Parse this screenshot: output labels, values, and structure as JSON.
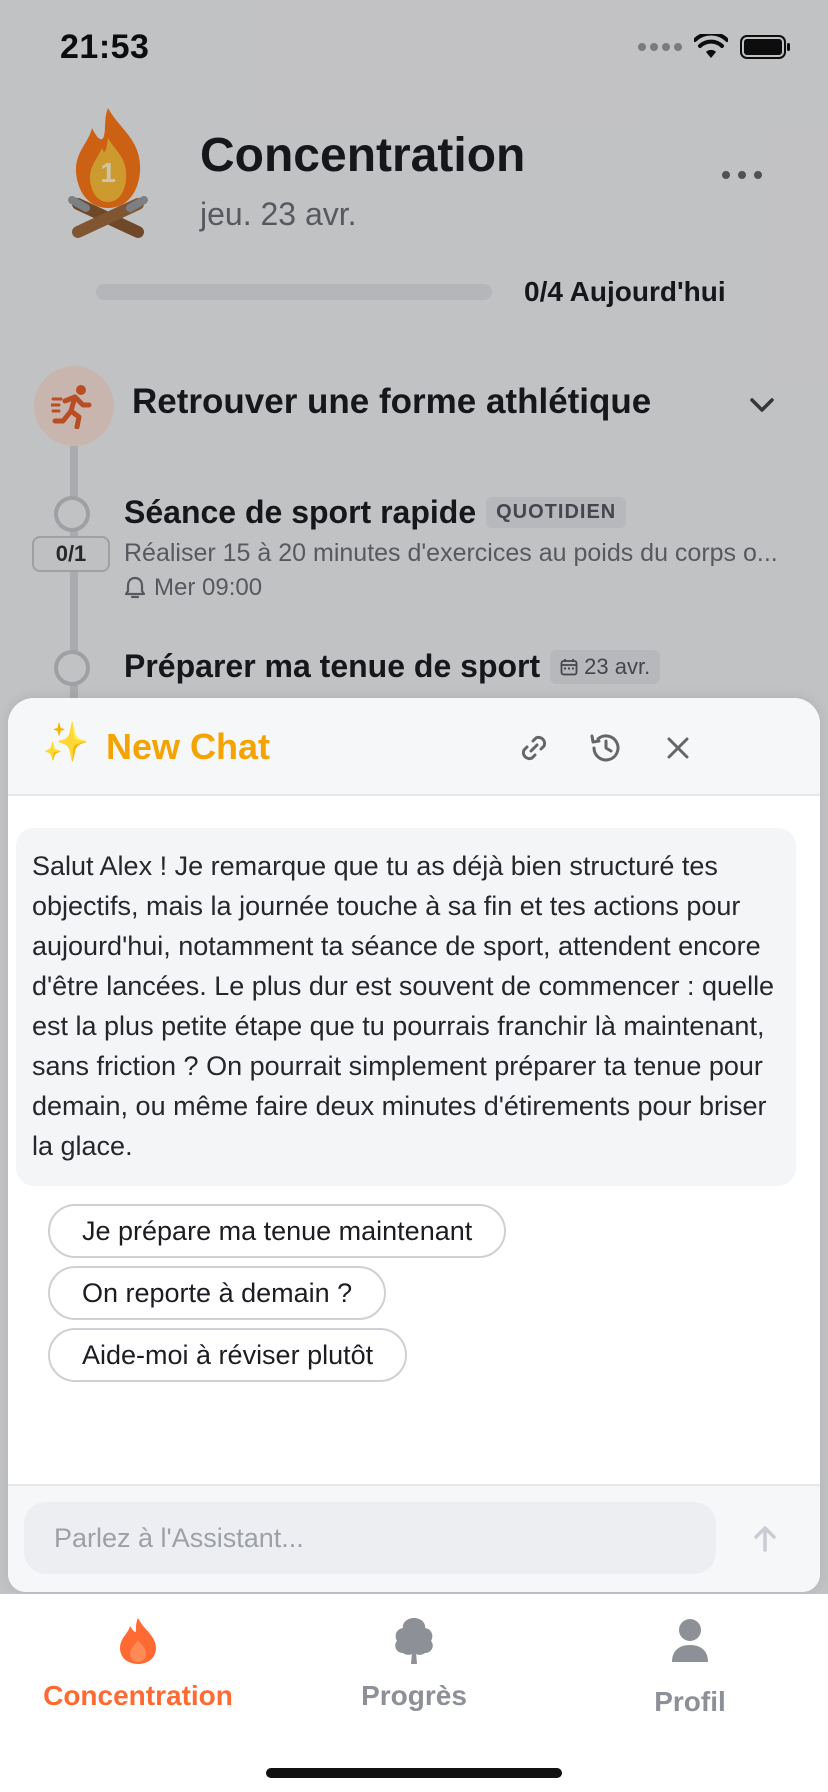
{
  "status_bar": {
    "time": "21:53"
  },
  "header": {
    "emoji": "🔥",
    "streak": "1",
    "title": "Concentration",
    "date": "jeu. 23 avr."
  },
  "progress": {
    "value": 0,
    "label": "0/4 Aujourd'hui"
  },
  "goal": {
    "title": "Retrouver une forme athlétique",
    "tasks": [
      {
        "title": "Séance de sport rapide",
        "tag": "QUOTIDIEN",
        "description": "Réaliser 15 à 20 minutes d'exercices au poids du corps o...",
        "reminder": "Mer 09:00",
        "count": "0/1"
      },
      {
        "title": "Préparer ma tenue de sport",
        "tag": "23 avr."
      }
    ]
  },
  "chat": {
    "title": "New Chat",
    "message": "Salut Alex ! Je remarque que tu as déjà bien structuré tes objectifs, mais la journée touche à sa fin et tes actions pour aujourd'hui, notamment ta séance de sport, attendent encore d'être lancées. Le plus dur est souvent de commencer : quelle est la plus petite étape que tu pourrais franchir là maintenant, sans friction ? On pourrait simplement préparer ta tenue pour demain, ou même faire deux minutes d'étirements pour briser la glace.",
    "suggestions": [
      "Je prépare ma tenue maintenant",
      "On reporte à demain ?",
      "Aide-moi à réviser plutôt"
    ],
    "input_placeholder": "Parlez à l'Assistant..."
  },
  "tabs": [
    {
      "label": "Concentration",
      "icon": "flame-icon",
      "active": true
    },
    {
      "label": "Progrès",
      "icon": "tree-icon",
      "active": false
    },
    {
      "label": "Profil",
      "icon": "person-icon",
      "active": false
    }
  ],
  "colors": {
    "accent": "#ff6a33",
    "chat_title": "#f5a300",
    "tab_inactive": "#8e9097"
  }
}
